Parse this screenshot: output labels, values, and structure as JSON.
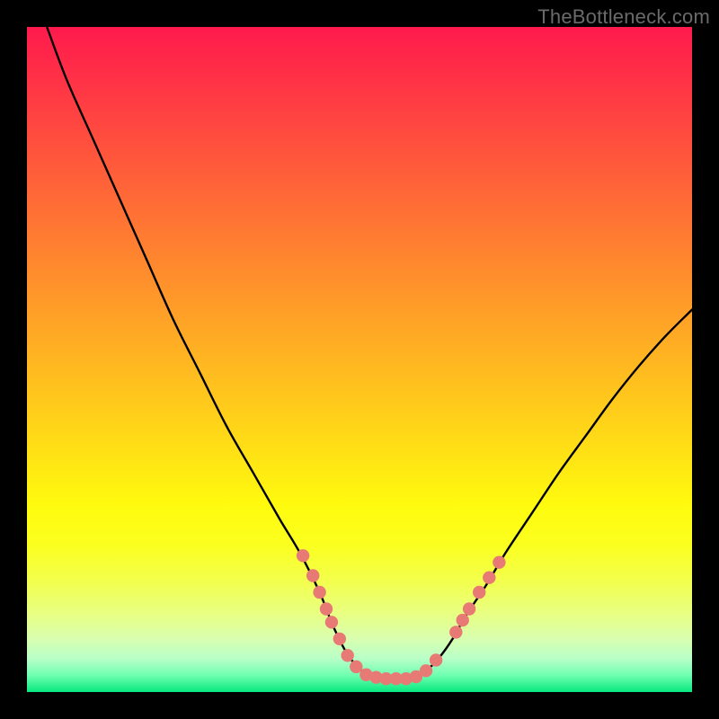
{
  "watermark": "TheBottleneck.com",
  "colors": {
    "frame": "#000000",
    "curve_stroke": "#000000",
    "dot_fill": "#e77a74",
    "gradient_top": "#ff1a4d",
    "gradient_bottom": "#07e87e"
  },
  "chart_data": {
    "type": "line",
    "title": "",
    "xlabel": "",
    "ylabel": "",
    "xlim": [
      0,
      100
    ],
    "ylim": [
      0,
      100
    ],
    "grid": false,
    "legend": false,
    "description": "V-shaped bottleneck curve. Left branch descends steeply from top-left; right branch ascends with a gentler curve toward mid-right. Trough is flat near y≈2 between roughly x≈48 and x≈58. Colored beads mark data points along both flanks near the trough.",
    "series": [
      {
        "name": "bottleneck-curve-left",
        "x": [
          3,
          6,
          10,
          14,
          18,
          22,
          26,
          30,
          34,
          38,
          41,
          44,
          46,
          48,
          50,
          52,
          54,
          56,
          58
        ],
        "y": [
          100,
          92,
          83,
          74,
          65,
          56,
          48,
          40,
          33,
          26,
          21,
          15,
          10,
          6,
          3.5,
          2.3,
          2,
          2,
          2.2
        ]
      },
      {
        "name": "bottleneck-curve-right",
        "x": [
          58,
          60,
          62,
          64,
          66,
          69,
          72,
          76,
          80,
          84,
          88,
          92,
          96,
          100
        ],
        "y": [
          2.2,
          3.2,
          5.2,
          8,
          11.5,
          16,
          21,
          27,
          33,
          38.5,
          44,
          49,
          53.5,
          57.5
        ]
      }
    ],
    "dots": {
      "name": "marker-beads",
      "note": "Muted-red dots clustered along the lower flanks and trough of the curve.",
      "points": [
        {
          "x": 41.5,
          "y": 20.5
        },
        {
          "x": 43.0,
          "y": 17.5
        },
        {
          "x": 44.0,
          "y": 15.0
        },
        {
          "x": 45.0,
          "y": 12.5
        },
        {
          "x": 45.8,
          "y": 10.5
        },
        {
          "x": 47.0,
          "y": 8.0
        },
        {
          "x": 48.2,
          "y": 5.5
        },
        {
          "x": 49.5,
          "y": 3.8
        },
        {
          "x": 51.0,
          "y": 2.6
        },
        {
          "x": 52.5,
          "y": 2.2
        },
        {
          "x": 54.0,
          "y": 2.0
        },
        {
          "x": 55.5,
          "y": 2.0
        },
        {
          "x": 57.0,
          "y": 2.0
        },
        {
          "x": 58.5,
          "y": 2.3
        },
        {
          "x": 60.0,
          "y": 3.2
        },
        {
          "x": 61.5,
          "y": 4.8
        },
        {
          "x": 64.5,
          "y": 9.0
        },
        {
          "x": 65.5,
          "y": 10.8
        },
        {
          "x": 66.5,
          "y": 12.5
        },
        {
          "x": 68.0,
          "y": 15.0
        },
        {
          "x": 69.5,
          "y": 17.2
        },
        {
          "x": 71.0,
          "y": 19.5
        }
      ]
    }
  }
}
